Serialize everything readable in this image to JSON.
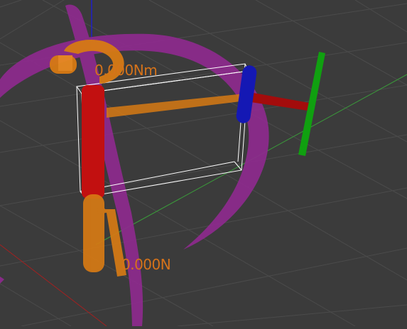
{
  "scene": {
    "background_color": "#3b3b3b",
    "grid_color": "#4a4a4a",
    "axis_x_color": "#a32020",
    "axis_y_color": "#3a9a3a",
    "axis_z_color": "#2020c8"
  },
  "overlay": {
    "torque_text": "0.000Nm",
    "force_text": "0.000N",
    "label_color": "#d6731a"
  },
  "gizmo": {
    "torque_ring_color": "#8e2a8e",
    "force_arrow_color": "#d77a14",
    "link_color": "#c21010",
    "joint_blue_color": "#1418b4",
    "joint_green_color": "#10a010",
    "bounding_box_color": "#ffffff"
  }
}
